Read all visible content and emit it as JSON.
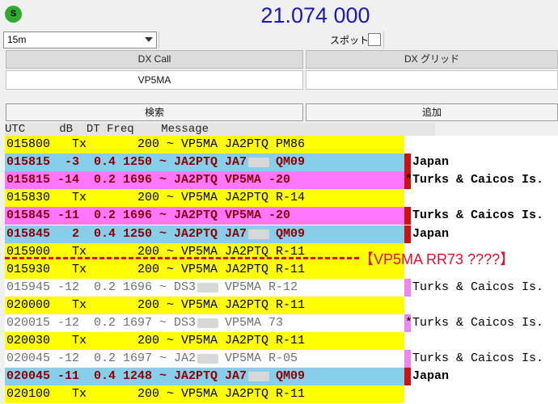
{
  "header": {
    "status_letter": "S",
    "frequency": "21.074 000"
  },
  "controls": {
    "band_value": "15m",
    "spot_label": "スポット"
  },
  "dx": {
    "call_header": "DX Call",
    "grid_header": "DX グリッド",
    "call_value": "VP5MA",
    "grid_value": "",
    "search_button": "検索",
    "add_button": "追加"
  },
  "table": {
    "header": "UTC     dB  DT Freq    Message",
    "rows": [
      {
        "text": "015800   Tx       200 ~ VP5MA JA2PTQ PM86",
        "bg": "#ffff00",
        "color": "#000000",
        "bold": false
      },
      {
        "text": "015815  -3  0.4 1250 ~ JA2PTQ JA7",
        "suffix": "QM09",
        "bg": "#87ceeb",
        "color": "#8b0000",
        "bold": true,
        "marker": "#cc1111",
        "country": "Japan",
        "country_bold": true
      },
      {
        "text": "015815 -14  0.2 1696 ~ JA2PTQ VP5MA -20",
        "bg": "#ff77ff",
        "color": "#8b0000",
        "bold": true,
        "marker": "#cc1111",
        "country": "*Turks & Caicos Is.",
        "country_bold": true
      },
      {
        "text": "015830   Tx       200 ~ VP5MA JA2PTQ R-14",
        "bg": "#ffff00",
        "color": "#000000",
        "bold": false
      },
      {
        "text": "015845 -11  0.2 1696 ~ JA2PTQ VP5MA -20",
        "bg": "#ff77ff",
        "color": "#8b0000",
        "bold": true,
        "marker": "#cc1111",
        "country": "Turks & Caicos Is.",
        "country_bold": true
      },
      {
        "text": "015845   2  0.4 1250 ~ JA2PTQ JA7",
        "suffix": "QM09",
        "bg": "#87ceeb",
        "color": "#8b0000",
        "bold": true,
        "marker": "#cc1111",
        "country": "Japan",
        "country_bold": true
      },
      {
        "text": "015900   Tx       200 ~ VP5MA JA2PTQ R-11",
        "bg": "#ffff00",
        "color": "#000000",
        "bold": false
      },
      {
        "text": "015930   Tx       200 ~ VP5MA JA2PTQ R-11",
        "bg": "#ffff00",
        "color": "#000000",
        "bold": false
      },
      {
        "text": "015945 -12  0.2 1696 ~ DS3",
        "suffix": "VP5MA R-12",
        "bg": "#ffffff",
        "color": "#707070",
        "bold": false,
        "marker": "#ee88ee",
        "country": "Turks & Caicos Is.",
        "country_bold": false
      },
      {
        "text": "020000   Tx       200 ~ VP5MA JA2PTQ R-11",
        "bg": "#ffff00",
        "color": "#000000",
        "bold": false
      },
      {
        "text": "020015 -12  0.2 1697 ~ DS3",
        "suffix": "VP5MA 73",
        "bg": "#ffffff",
        "color": "#707070",
        "bold": false,
        "marker": "#ee88ee",
        "country": "*Turks & Caicos Is.",
        "country_bold": false
      },
      {
        "text": "020030   Tx       200 ~ VP5MA JA2PTQ R-11",
        "bg": "#ffff00",
        "color": "#000000",
        "bold": false
      },
      {
        "text": "020045 -12  0.2 1697 ~ JA2",
        "suffix": "VP5MA R-05",
        "bg": "#ffffff",
        "color": "#707070",
        "bold": false,
        "marker": "#ee88ee",
        "country": "Turks & Caicos Is.",
        "country_bold": false
      },
      {
        "text": "020045 -11  0.4 1248 ~ JA2PTQ JA7",
        "suffix": "QM09",
        "bg": "#87ceeb",
        "color": "#8b0000",
        "bold": true,
        "marker": "#cc1111",
        "country": "Japan",
        "country_bold": true
      },
      {
        "text": "020100   Tx       200 ~ VP5MA JA2PTQ R-11",
        "bg": "#ffff00",
        "color": "#000000",
        "bold": false
      }
    ]
  },
  "annotation": "【VP5MA RR73 ????】"
}
